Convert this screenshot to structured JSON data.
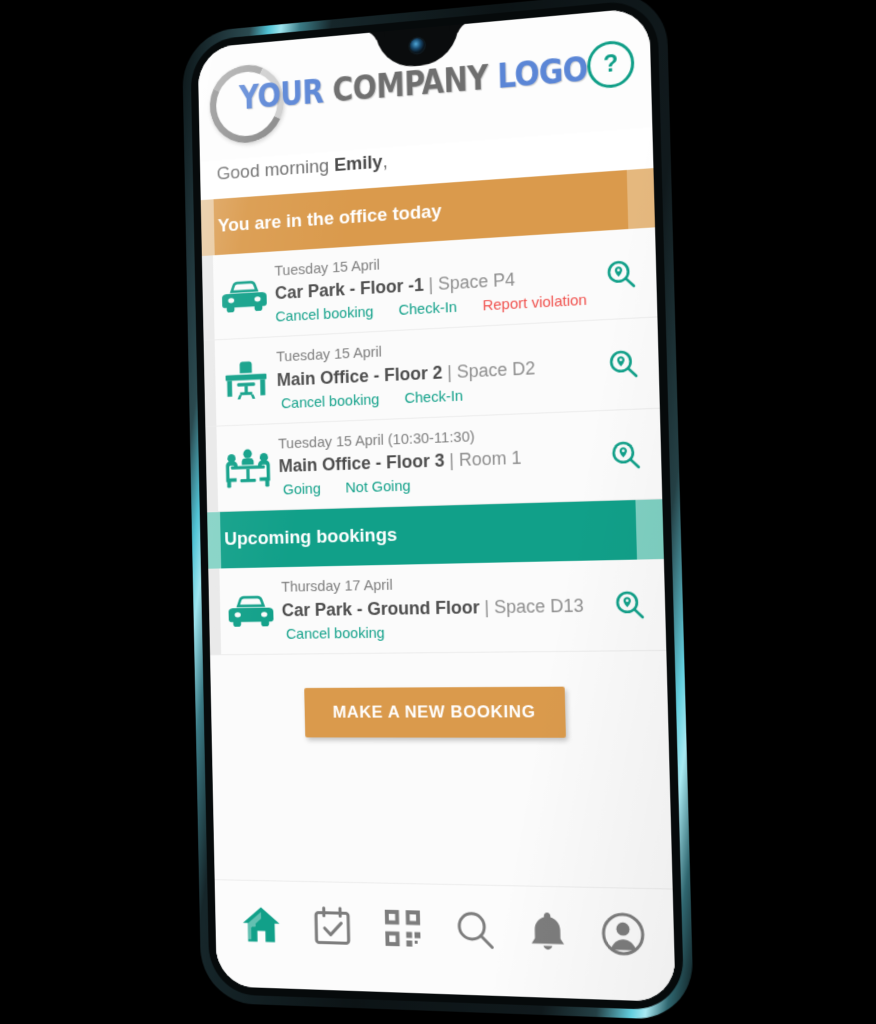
{
  "header": {
    "logo": {
      "word1": "YOUR",
      "word2": "COMPANY",
      "word3": "LOGO",
      "ring_icon": "circle-swoosh-icon"
    },
    "help_label": "?",
    "help_icon": "question-mark-icon"
  },
  "greeting": {
    "prefix": "Good morning ",
    "name": "Emily",
    "suffix": ","
  },
  "sections": [
    {
      "id": "today",
      "title": "You are in the office today",
      "color": "#da9a4c"
    },
    {
      "id": "upcoming",
      "title": "Upcoming bookings",
      "color": "#11a089"
    }
  ],
  "today_bookings": [
    {
      "icon": "car-icon",
      "date": "Tuesday 15 April",
      "location": "Car Park - Floor -1",
      "separator": " | ",
      "space": "Space P4",
      "pin_icon": "map-search-icon",
      "actions": [
        {
          "label": "Cancel booking",
          "style": "link"
        },
        {
          "label": "Check-In",
          "style": "link"
        },
        {
          "label": "Report violation",
          "style": "danger"
        }
      ]
    },
    {
      "icon": "desk-icon",
      "date": "Tuesday 15 April",
      "location": "Main Office - Floor  2",
      "separator": " | ",
      "space": "Space D2",
      "pin_icon": "map-search-icon",
      "actions": [
        {
          "label": "Cancel booking",
          "style": "link"
        },
        {
          "label": "Check-In",
          "style": "link"
        }
      ]
    },
    {
      "icon": "meeting-icon",
      "date": "Tuesday 15 April (10:30-11:30)",
      "location": "Main Office - Floor 3",
      "separator": " | ",
      "space": "Room 1",
      "pin_icon": "map-search-icon",
      "actions": [
        {
          "label": "Going",
          "style": "link"
        },
        {
          "label": "Not Going",
          "style": "link"
        }
      ]
    }
  ],
  "upcoming_bookings": [
    {
      "icon": "car-icon",
      "date": "Thursday 17 April",
      "location": "Car Park - Ground Floor",
      "separator": " | ",
      "space": "Space D13",
      "pin_icon": "map-search-icon",
      "actions": [
        {
          "label": "Cancel booking",
          "style": "link"
        }
      ]
    }
  ],
  "cta": {
    "label": "MAKE A NEW BOOKING"
  },
  "bottom_nav": [
    {
      "name": "home",
      "icon": "home-icon",
      "active": true
    },
    {
      "name": "bookings",
      "icon": "calendar-check-icon",
      "active": false
    },
    {
      "name": "scan",
      "icon": "qr-code-icon",
      "active": false
    },
    {
      "name": "search",
      "icon": "search-icon",
      "active": false
    },
    {
      "name": "notifications",
      "icon": "bell-icon",
      "active": false
    },
    {
      "name": "profile",
      "icon": "user-circle-icon",
      "active": false
    }
  ],
  "colors": {
    "teal": "#11a089",
    "orange": "#da9a4c",
    "danger": "#f0504c",
    "logo_blue": "#5b86d6",
    "logo_grey": "#6f6f6f"
  }
}
